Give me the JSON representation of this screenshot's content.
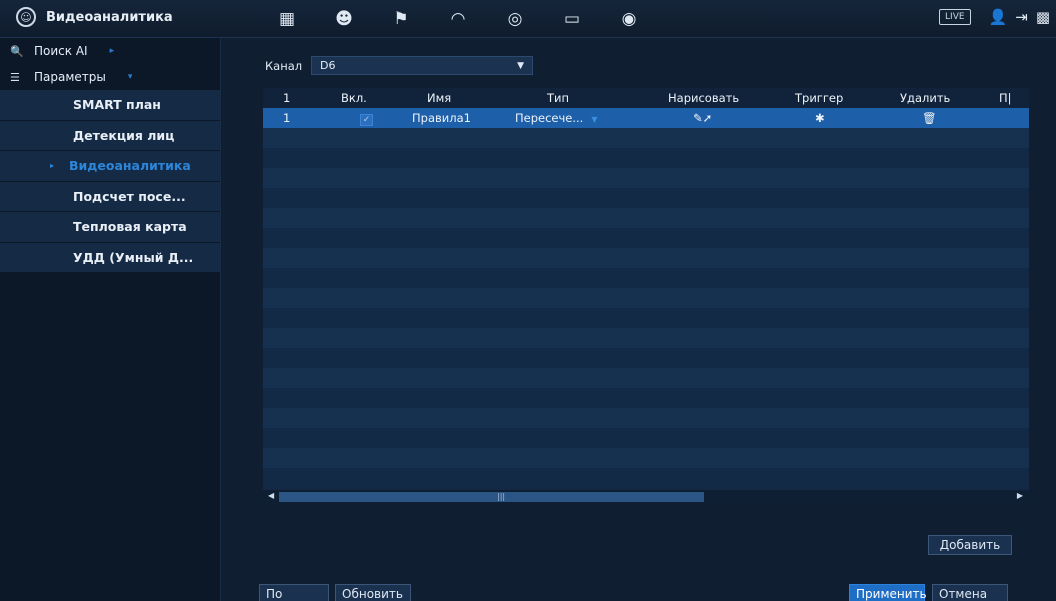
{
  "app": {
    "title": "Видеоаналитика"
  },
  "topbar": {
    "icons": [
      "video-icon",
      "face-ai-icon",
      "alarm-icon",
      "speed-gauge-icon",
      "record-icon",
      "monitor-icon",
      "audio-icon"
    ],
    "live_label": "LIVE"
  },
  "sidebar": {
    "search_label": "Поиск AI",
    "params_label": "Параметры",
    "items": [
      {
        "label": "SMART план"
      },
      {
        "label": "Детекция лиц"
      },
      {
        "label": "Видеоаналитика",
        "active": true
      },
      {
        "label": "Подсчет посе..."
      },
      {
        "label": "Тепловая карта"
      },
      {
        "label": "УДД (Умный Д..."
      }
    ]
  },
  "channel": {
    "label": "Канал",
    "value": "D6"
  },
  "table": {
    "columns": [
      "1",
      "Вкл.",
      "Имя",
      "Тип",
      "Нарисовать",
      "Триггер",
      "Удалить",
      "П|"
    ],
    "rows": [
      {
        "num": "1",
        "enabled": true,
        "name": "Правила1",
        "type": "Пересече..."
      }
    ]
  },
  "buttons": {
    "add": "Добавить",
    "default": "По умолч...",
    "refresh": "Обновить",
    "apply": "Применить",
    "cancel": "Отмена"
  },
  "colors": {
    "accent": "#1d6ec4",
    "active_text": "#2d86da"
  }
}
